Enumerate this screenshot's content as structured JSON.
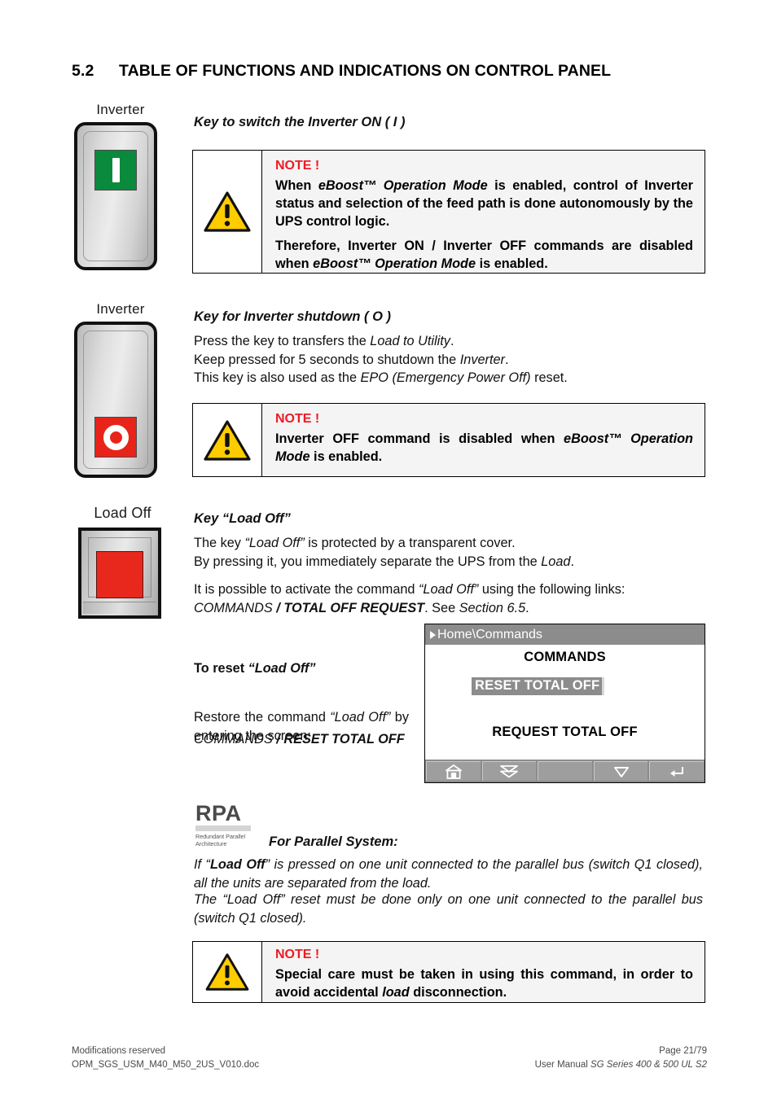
{
  "heading": {
    "number": "5.2",
    "title": "TABLE OF FUNCTIONS AND INDICATIONS ON CONTROL PANEL"
  },
  "sections": {
    "inverter_on": {
      "key_caption": "Inverter",
      "key_glyph": "I",
      "key_color": "#0a8a3c",
      "subtitle": "Key to switch the Inverter ON ( I )",
      "note": {
        "label": "NOTE !",
        "p1_a": "When ",
        "p1_b": "eBoost™ Operation Mode",
        "p1_c": " is enabled, control of Inverter status and selection of the feed path is done autonomously by the UPS control logic.",
        "p2_a": "Therefore, Inverter ON / Inverter OFF commands are disabled when ",
        "p2_b": "eBoost™ Operation Mode",
        "p2_c": " is enabled."
      }
    },
    "inverter_off": {
      "key_caption": "Inverter",
      "key_glyph": "O",
      "key_color": "#e8241a",
      "subtitle": "Key for Inverter shutdown ( O )",
      "line1_a": "Press the key to transfers the ",
      "line1_b": "Load to Utility",
      "line1_c": ".",
      "line2_a": "Keep pressed for 5 seconds to shutdown the ",
      "line2_b": "Inverter",
      "line2_c": ".",
      "line3_a": "This key is also used as the ",
      "line3_b": "EPO (Emergency Power Off)",
      "line3_c": " reset.",
      "note": {
        "label": "NOTE !",
        "p1_a": "Inverter OFF command is disabled when ",
        "p1_b": "eBoost™ Operation Mode",
        "p1_c": " is enabled."
      }
    },
    "load_off": {
      "key_caption": "Load Off",
      "key_color": "#e8281c",
      "subtitle": "Key “Load Off”",
      "line1_a": "The key ",
      "line1_b": "“Load Off”",
      "line1_c": " is protected by a transparent cover.",
      "line2_a": "By pressing it, you immediately separate the UPS from the ",
      "line2_b": "Load",
      "line2_c": ".",
      "line3_a": "It is possible to activate the command ",
      "line3_b": "“Load Off”",
      "line3_c": " using the following links:",
      "line4_a": "COMMANDS",
      "line4_b": " / ",
      "line4_c": "TOTAL OFF REQUEST",
      "line4_d": ". See ",
      "line4_e": "Section 6.5",
      "line4_f": "."
    },
    "reset_load_off": {
      "subtitle_a": "To reset ",
      "subtitle_b": "“Load Off”",
      "p_a": "Restore the command ",
      "p_b": "“Load Off”",
      "p_c": " by entering the screen:",
      "path_a": "COMMANDS",
      "path_b": " / ",
      "path_c": "RESET TOTAL OFF"
    },
    "parallel": {
      "logo_mark": "RPA",
      "logo_sub_line1": "Redundant Parallel",
      "logo_sub_line2": "Architecture",
      "subtitle": "For Parallel System:",
      "p1_a": "If “",
      "p1_b": "Load Off",
      "p1_c": "” is pressed on one unit connected to the parallel bus (switch Q1 closed), all the units are separated from the load.",
      "p2": "The “Load Off” reset must be done only on one unit connected to the parallel bus (switch Q1 closed).",
      "note": {
        "label": "NOTE !",
        "p1_a": "Special care must be taken in using this command, in order to avoid accidental ",
        "p1_b": "load",
        "p1_c": " disconnection."
      }
    }
  },
  "lcd": {
    "breadcrumb": "Home\\Commands",
    "title": "COMMANDS",
    "selected_item": "RESET TOTAL OFF",
    "item_2": "REQUEST TOTAL OFF",
    "buttons": [
      "home-icon",
      "double-down-chevron-icon",
      "blank",
      "down-triangle-icon",
      "enter-return-icon"
    ],
    "accent_gray": "#8c8c8c"
  },
  "footer": {
    "left_line1": "Modifications reserved",
    "left_line2": "OPM_SGS_USM_M40_M50_2US_V010.doc",
    "right_line1": "Page 21/79",
    "right_line2_a": "User Manual ",
    "right_line2_b": "SG Series 400 & 500 UL S2"
  },
  "colors": {
    "note_red": "#ee1b24",
    "warn_yellow": "#ffcc00",
    "note_bg": "#f4f4f4"
  }
}
